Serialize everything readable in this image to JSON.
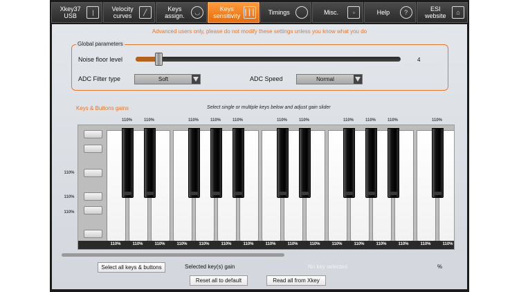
{
  "toolbar": {
    "tabs": [
      {
        "label": "Xkey37 USB",
        "icon": "slider-icon"
      },
      {
        "label": "Velocity\ncurves",
        "icon": "curve-icon"
      },
      {
        "label": "Keys\nassign.",
        "icon": "dial-icon"
      },
      {
        "label": "Keys\nsensitivity",
        "icon": "keyboard-icon",
        "active": true
      },
      {
        "label": "Timings",
        "icon": "stopwatch-icon"
      },
      {
        "label": "Misc.",
        "icon": "squares-icon"
      },
      {
        "label": "Help",
        "icon": "question-icon"
      },
      {
        "label": "ESI\nwebsite",
        "icon": "home-icon"
      }
    ]
  },
  "warning": "Advanced users only, please do not modify these settings unless you know what you do",
  "global": {
    "title": "Global parameters",
    "noise_label": "Noise floor level",
    "noise_value": "4",
    "noise_fraction": 0.05,
    "filter_label": "ADC Filter type",
    "filter_value": "Soft",
    "speed_label": "ADC Speed",
    "speed_value": "Normal"
  },
  "keys": {
    "title": "Keys & Buttons gains",
    "hint": "Select single or multiple keys below and adjust gain slider",
    "gain": "110%",
    "side_gains": [
      "110%",
      "110%",
      "110%"
    ]
  },
  "bottom": {
    "select_all": "Select all keys & buttons",
    "selected_gain_label": "Selected key(s) gain",
    "no_key": "No key selected",
    "percent": "%",
    "reset": "Reset all to default",
    "read": "Read all from Xkey"
  },
  "colors": {
    "accent": "#e8762a",
    "active_tab": "#f28a2e"
  }
}
